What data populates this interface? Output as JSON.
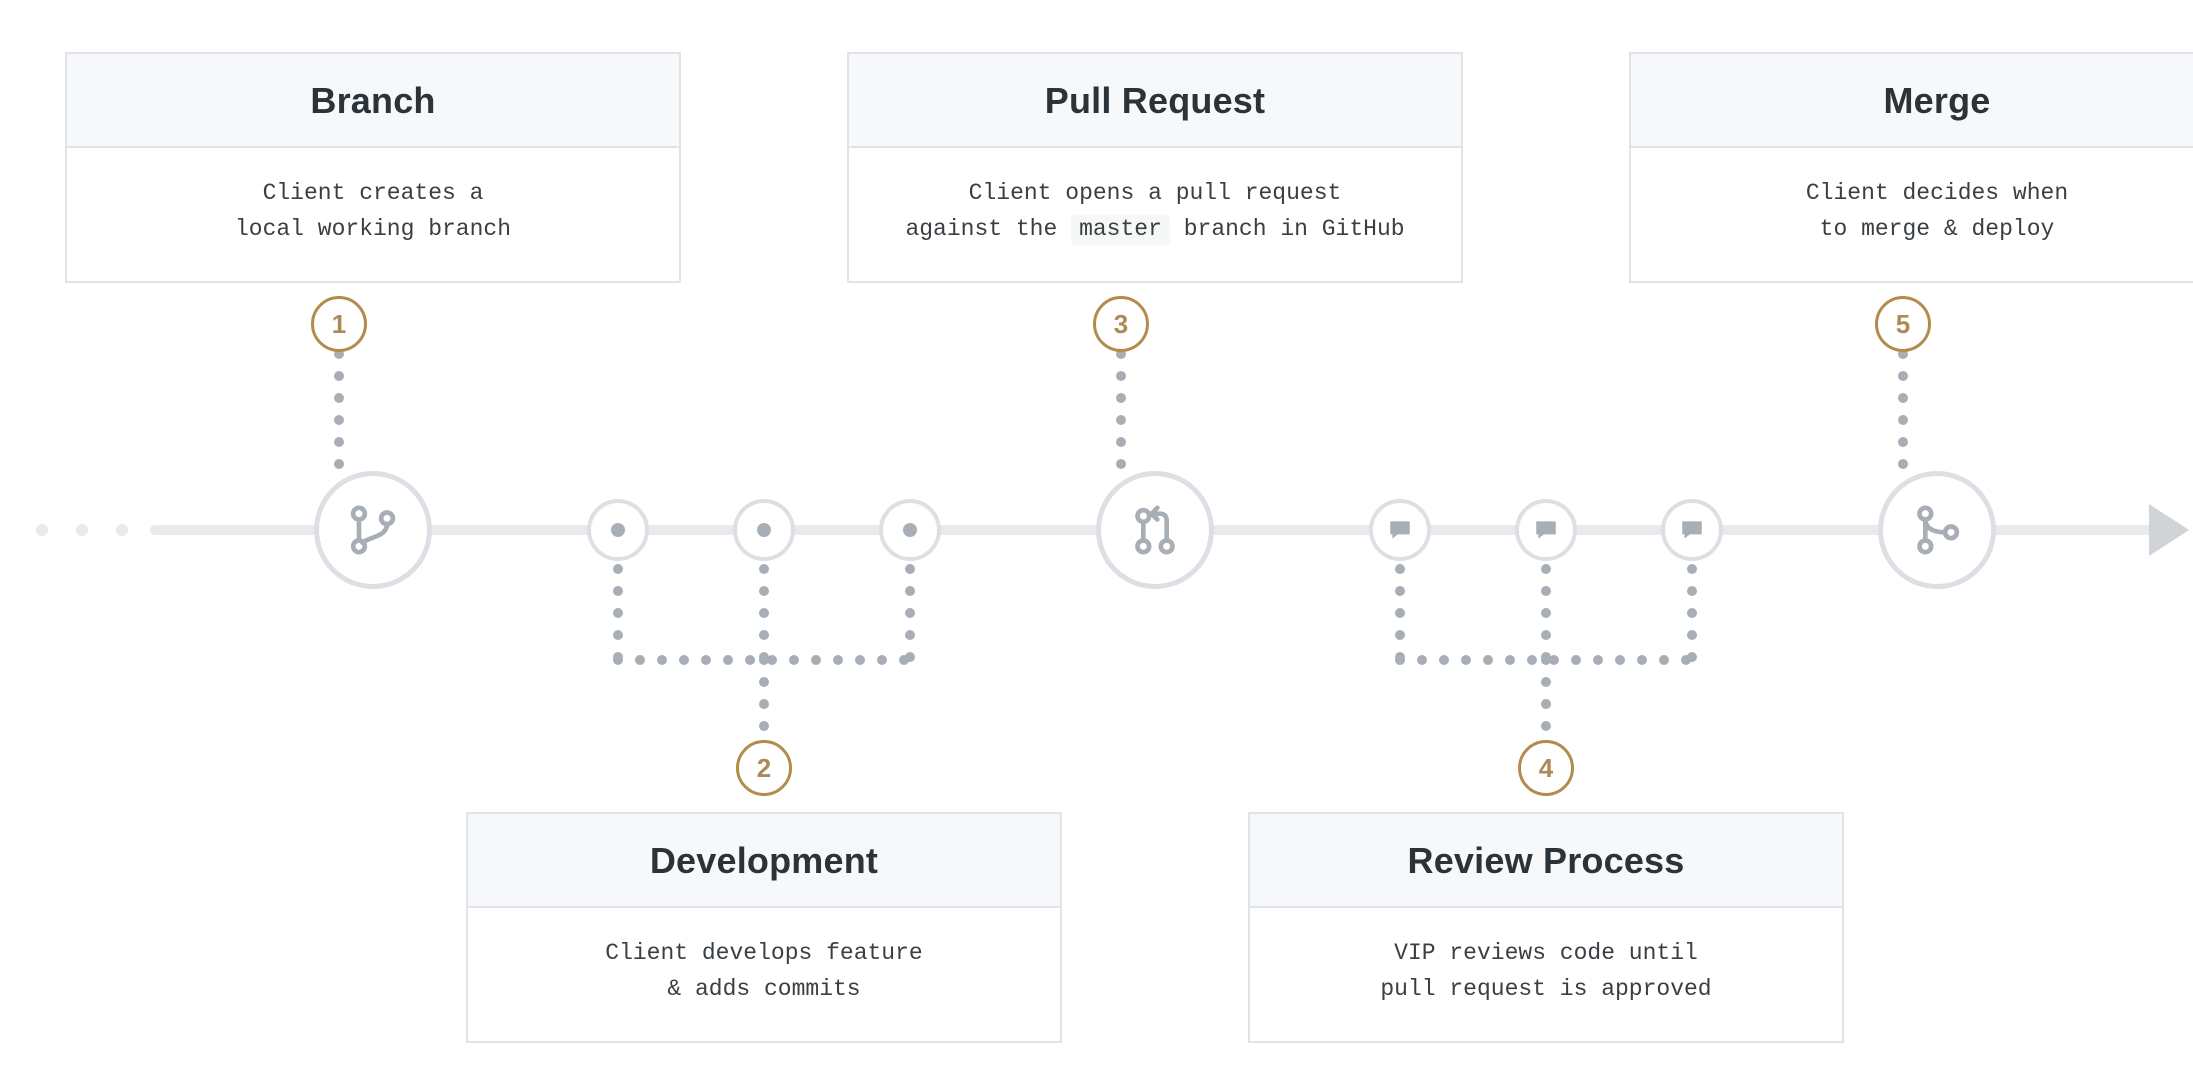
{
  "steps": [
    {
      "n": "1",
      "title": "Branch",
      "body": "Client creates a\nlocal working branch",
      "position": "top",
      "icon": "branch"
    },
    {
      "n": "2",
      "title": "Development",
      "body": "Client develops feature\n& adds commits",
      "position": "bottom",
      "group_icon": "commit",
      "group_count": 3
    },
    {
      "n": "3",
      "title": "Pull Request",
      "body_html": "Client opens a pull request\nagainst the <code>master</code> branch in GitHub",
      "position": "top",
      "icon": "pull-request"
    },
    {
      "n": "4",
      "title": "Review Process",
      "body": "VIP reviews code until\npull request is approved",
      "position": "bottom",
      "group_icon": "comment",
      "group_count": 3
    },
    {
      "n": "5",
      "title": "Merge",
      "body": "Client decides when\nto merge & deploy",
      "position": "top",
      "icon": "merge"
    }
  ],
  "colors": {
    "accent": "#b38b4d",
    "gray": "#a8aeb5",
    "card_border": "#e0e3e8",
    "header_bg": "#f6f8f9"
  },
  "axis_leading_dots": 3
}
